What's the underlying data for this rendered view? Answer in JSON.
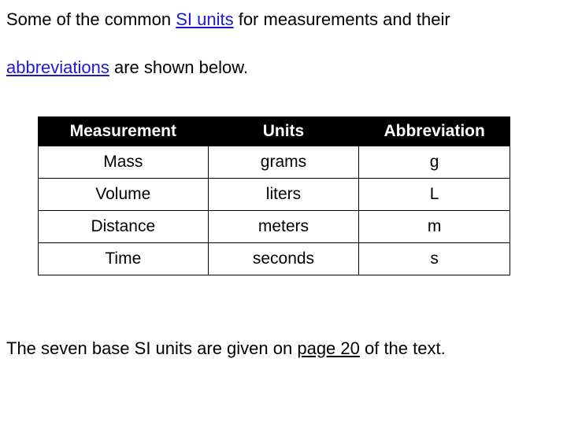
{
  "intro": {
    "part1": "Some of the common ",
    "blue": "SI units",
    "part2": " for measurements and their ",
    "blue2": "abbreviations",
    "part3": " are shown below."
  },
  "table": {
    "headers": {
      "measurement": "Measurement",
      "units": "Units",
      "abbreviation": "Abbreviation"
    },
    "rows": [
      {
        "measurement": "Mass",
        "units": "grams",
        "abbreviation": "g"
      },
      {
        "measurement": "Volume",
        "units": "liters",
        "abbreviation": "L"
      },
      {
        "measurement": "Distance",
        "units": "meters",
        "abbreviation": "m"
      },
      {
        "measurement": "Time",
        "units": "seconds",
        "abbreviation": "s"
      }
    ]
  },
  "footer": {
    "part1": "The seven base SI units  are given on ",
    "page_ref": "page 20",
    "part2": " of the text."
  }
}
